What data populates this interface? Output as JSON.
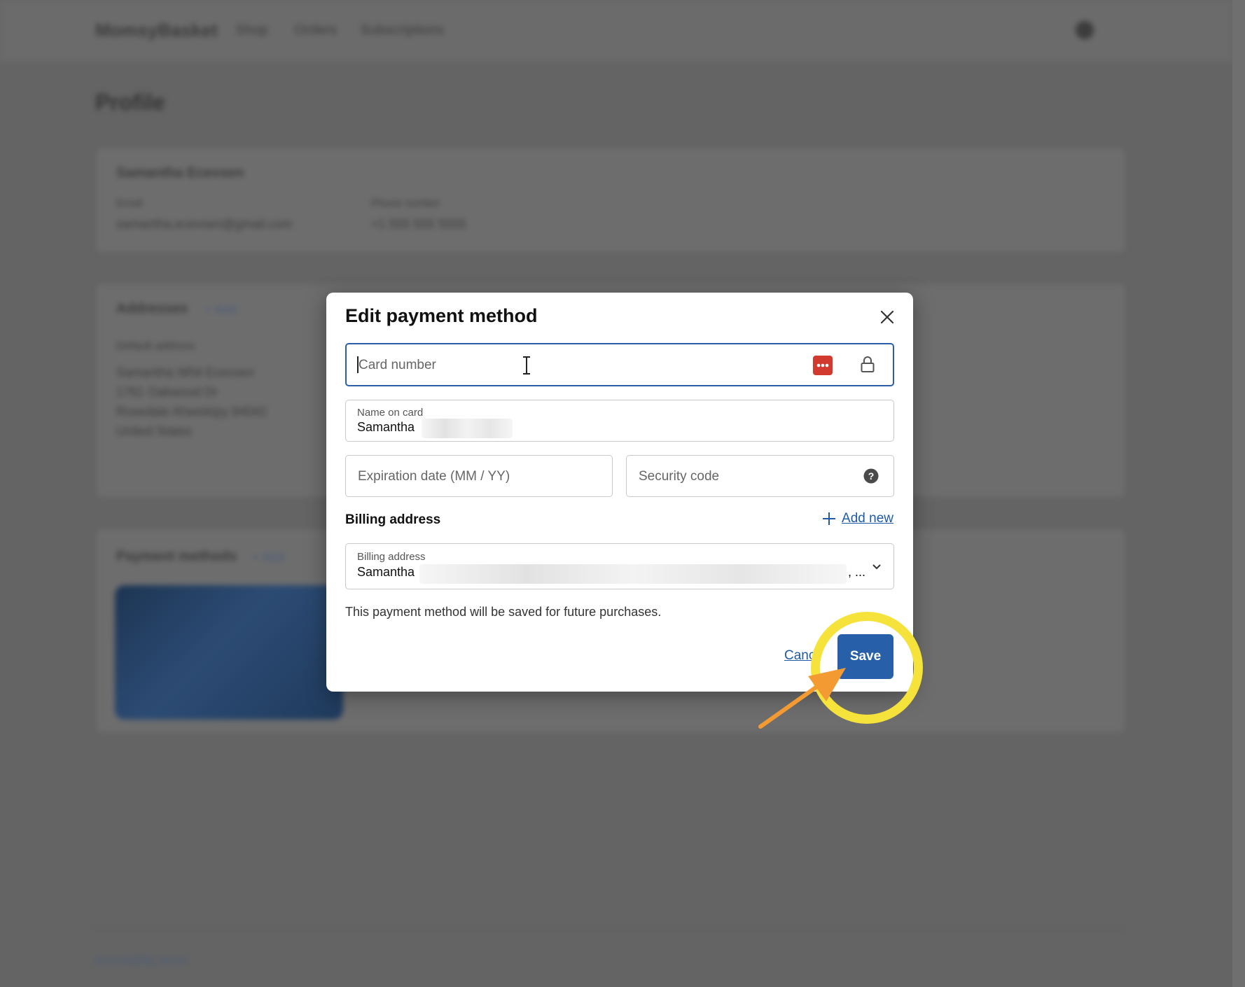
{
  "background": {
    "brand": "MomsyBasket",
    "nav": [
      "Shop",
      "Orders",
      "Subscriptions"
    ],
    "page_title": "Profile",
    "account_name": "Samantha Ecevsen",
    "email_label": "Email",
    "email_value": "samantha.ecevsen@gmail.com",
    "phone_label": "Phone number",
    "phone_value": "+1 555 555 5555",
    "addresses_title": "Addresses",
    "addresses_add": "+ Add",
    "default_address_label": "Default address",
    "address_lines": [
      "Samantha Whit Ecevsen",
      "1761 Oakwood Dr",
      "Rosedale Ahwiskipy 84042",
      "United States"
    ],
    "payment_title": "Payment methods",
    "payment_add": "+ Add",
    "footer_link": "Accessibility terms"
  },
  "modal": {
    "title": "Edit payment method",
    "card_number_placeholder": "Card number",
    "name_on_card_label": "Name on card",
    "name_on_card_value": "Samantha",
    "expiration_placeholder": "Expiration date (MM / YY)",
    "security_code_placeholder": "Security code",
    "billing_section_label": "Billing address",
    "add_new_label": "Add new",
    "billing_select_label": "Billing address",
    "billing_select_value": "Samantha",
    "billing_select_ellipsis": ", ...",
    "note": "This payment method will be saved for future purchases.",
    "cancel_label": "Cancel",
    "save_label": "Save"
  },
  "colors": {
    "primary": "#2760a8",
    "link": "#1e5aa8",
    "highlight": "#f5e23a",
    "arrow": "#f39a33",
    "password_manager": "#d33a2f"
  },
  "icons": [
    "close-icon",
    "password-manager-icon",
    "lock-icon",
    "help-icon",
    "plus-icon",
    "chevron-down-icon",
    "text-cursor-icon"
  ]
}
